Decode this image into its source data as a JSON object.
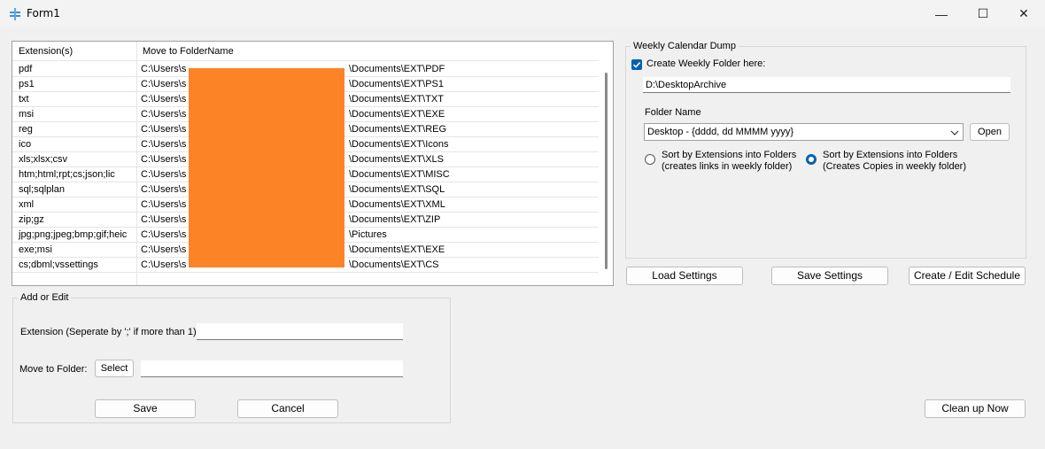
{
  "window": {
    "title": "Form1",
    "minimize": "—",
    "maximize": "☐",
    "close": "✕"
  },
  "grid": {
    "columns": [
      "Extension(s)",
      "Move to FolderName"
    ],
    "rows": [
      {
        "ext": "pdf",
        "prefix": "C:\\Users\\s",
        "suffix": "\\Documents\\EXT\\PDF"
      },
      {
        "ext": "ps1",
        "prefix": "C:\\Users\\s",
        "suffix": "\\Documents\\EXT\\PS1"
      },
      {
        "ext": "txt",
        "prefix": "C:\\Users\\s",
        "suffix": "\\Documents\\EXT\\TXT"
      },
      {
        "ext": "msi",
        "prefix": "C:\\Users\\s",
        "suffix": "\\Documents\\EXT\\EXE"
      },
      {
        "ext": "reg",
        "prefix": "C:\\Users\\s",
        "suffix": "\\Documents\\EXT\\REG"
      },
      {
        "ext": "ico",
        "prefix": "C:\\Users\\s",
        "suffix": "\\Documents\\EXT\\Icons"
      },
      {
        "ext": "xls;xlsx;csv",
        "prefix": "C:\\Users\\s",
        "suffix": "\\Documents\\EXT\\XLS"
      },
      {
        "ext": "htm;html;rpt;cs;json;lic",
        "prefix": "C:\\Users\\s",
        "suffix": "\\Documents\\EXT\\MISC"
      },
      {
        "ext": "sql;sqlplan",
        "prefix": "C:\\Users\\s",
        "suffix": "\\Documents\\EXT\\SQL"
      },
      {
        "ext": "xml",
        "prefix": "C:\\Users\\s",
        "suffix": "\\Documents\\EXT\\XML"
      },
      {
        "ext": "zip;gz",
        "prefix": "C:\\Users\\s",
        "suffix": "\\Documents\\EXT\\ZIP"
      },
      {
        "ext": "jpg;png;jpeg;bmp;gif;heic",
        "prefix": "C:\\Users\\s",
        "suffix": "\\Pictures"
      },
      {
        "ext": "exe;msi",
        "prefix": "C:\\Users\\s",
        "suffix": "\\Documents\\EXT\\EXE"
      },
      {
        "ext": "cs;dbml;vssettings",
        "prefix": "C:\\Users\\s",
        "suffix": "\\Documents\\EXT\\CS"
      }
    ]
  },
  "weekly": {
    "group_title": "Weekly Calendar Dump",
    "create_folder_label": "Create Weekly Folder here:",
    "create_folder_checked": true,
    "folder_path": "D:\\DesktopArchive",
    "folder_name_label": "Folder Name",
    "folder_name_value": "Desktop - {dddd, dd MMMM yyyy}",
    "open_button": "Open",
    "radio_links_line1": "Sort by Extensions into Folders",
    "radio_links_line2": "(creates links in weekly folder)",
    "radio_copies_line1": "Sort by Extensions into Folders",
    "radio_copies_line2": "(Creates Copies in weekly folder)",
    "selected_option": "copies"
  },
  "settings_buttons": {
    "load": "Load Settings",
    "save": "Save Settings",
    "schedule": "Create / Edit Schedule"
  },
  "add_edit": {
    "group_title": "Add or Edit",
    "extension_label": "Extension (Seperate by ';' if more than 1)",
    "extension_value": "",
    "move_label": "Move to Folder:",
    "select_button": "Select",
    "folder_value": "",
    "save_button": "Save",
    "cancel_button": "Cancel"
  },
  "cleanup_button": "Clean up Now",
  "colors": {
    "accent": "#0063b1",
    "redaction": "#fd8327"
  }
}
